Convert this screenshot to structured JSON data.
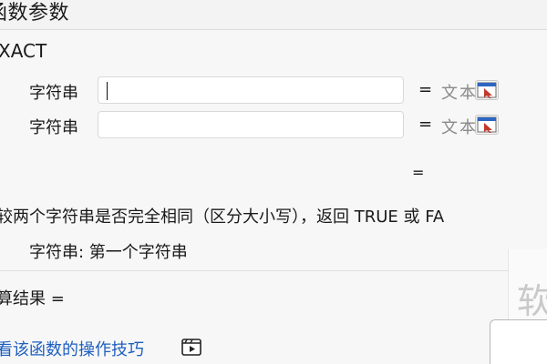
{
  "window": {
    "title": "函数参数"
  },
  "function": {
    "name": "XACT",
    "args": [
      {
        "label": "字符串",
        "value": "",
        "equals": "=",
        "hint": "文本"
      },
      {
        "label": "字符串",
        "value": "",
        "equals": "=",
        "hint": "文本"
      }
    ],
    "result_equals": "=",
    "description": "较两个字符串是否完全相同（区分大小写），返回 TRUE 或 FA",
    "arg_description": "字符串:  第一个字符串"
  },
  "calc_result": "算结果 =",
  "help_link": "看该函数的操作技巧",
  "watermark": "软",
  "icons": {
    "ref": "collapse-dialog-icon",
    "video": "video-icon"
  },
  "colors": {
    "link": "#1f5fbf",
    "hint": "#8a8a8a"
  }
}
